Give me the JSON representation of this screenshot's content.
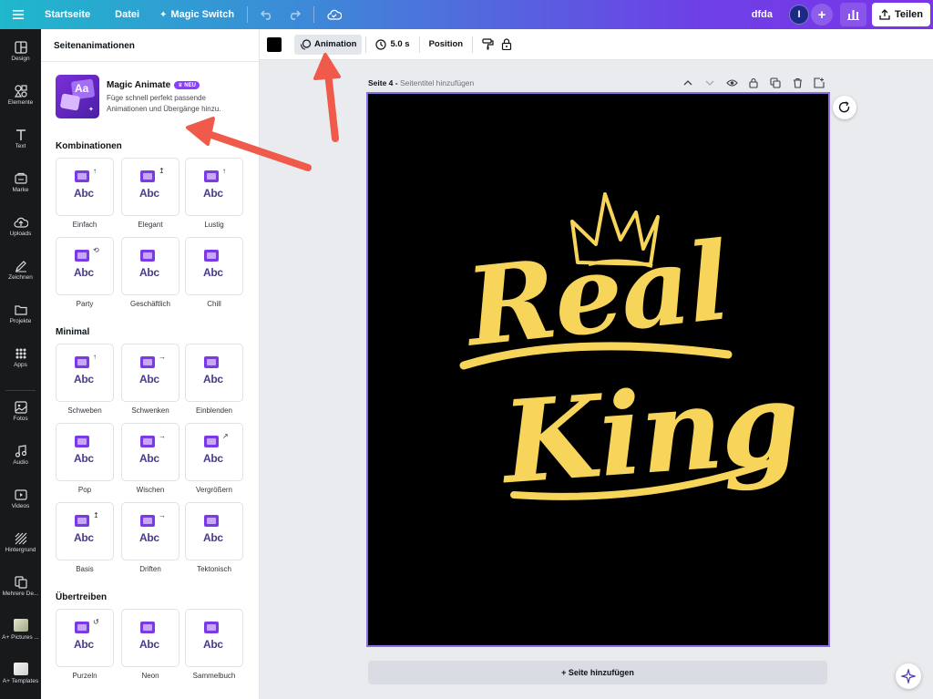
{
  "topbar": {
    "home": "Startseite",
    "file": "Datei",
    "magic_switch": "Magic Switch",
    "project_name": "dfda",
    "avatar_initial": "I",
    "share": "Teilen"
  },
  "rail": {
    "items": [
      {
        "label": "Design",
        "icon": "layout-icon"
      },
      {
        "label": "Elemente",
        "icon": "shapes-icon"
      },
      {
        "label": "Text",
        "icon": "text-icon"
      },
      {
        "label": "Marke",
        "icon": "brand-icon"
      },
      {
        "label": "Uploads",
        "icon": "cloud-upload-icon"
      },
      {
        "label": "Zeichnen",
        "icon": "pen-icon"
      },
      {
        "label": "Projekte",
        "icon": "folder-icon"
      },
      {
        "label": "Apps",
        "icon": "grid-icon"
      },
      {
        "label": "Fotos",
        "icon": "photo-icon"
      },
      {
        "label": "Audio",
        "icon": "music-note-icon"
      },
      {
        "label": "Videos",
        "icon": "video-icon"
      },
      {
        "label": "Hintergrund",
        "icon": "background-icon"
      },
      {
        "label": "Mehrere De...",
        "icon": "multi-design-icon"
      },
      {
        "label": "A+ Pictures ...",
        "icon": "app-thumbnail"
      },
      {
        "label": "A+ Templates",
        "icon": "app-thumbnail"
      }
    ]
  },
  "panel": {
    "title": "Seitenanimationen",
    "magic_animate": {
      "title": "Magic Animate",
      "badge": "NEU",
      "description": "Füge schnell perfekt passende Animationen und Übergänge hinzu."
    },
    "sections": [
      {
        "title": "Kombinationen",
        "tiles": [
          "Einfach",
          "Elegant",
          "Lustig",
          "Party",
          "Geschäftlich",
          "Chill"
        ]
      },
      {
        "title": "Minimal",
        "tiles": [
          "Schweben",
          "Schwenken",
          "Einblenden",
          "Pop",
          "Wischen",
          "Vergrößern",
          "Basis",
          "Driften",
          "Tektonisch"
        ]
      },
      {
        "title": "Übertreiben",
        "tiles": [
          "Purzeln",
          "Neon",
          "Sammelbuch"
        ]
      }
    ],
    "tile_text": "Abc"
  },
  "toolbar": {
    "animation": "Animation",
    "duration": "5.0 s",
    "position": "Position"
  },
  "canvas": {
    "page_label": "Seite 4 -",
    "page_title_placeholder": "Seitentitel hinzufügen",
    "art_line1": "Real",
    "art_line2": "King",
    "add_page": "+ Seite hinzufügen"
  },
  "colors": {
    "accent": "#8b3dff",
    "annotation_arrow": "#ef5a4b",
    "art_yellow": "#f7d45a"
  }
}
